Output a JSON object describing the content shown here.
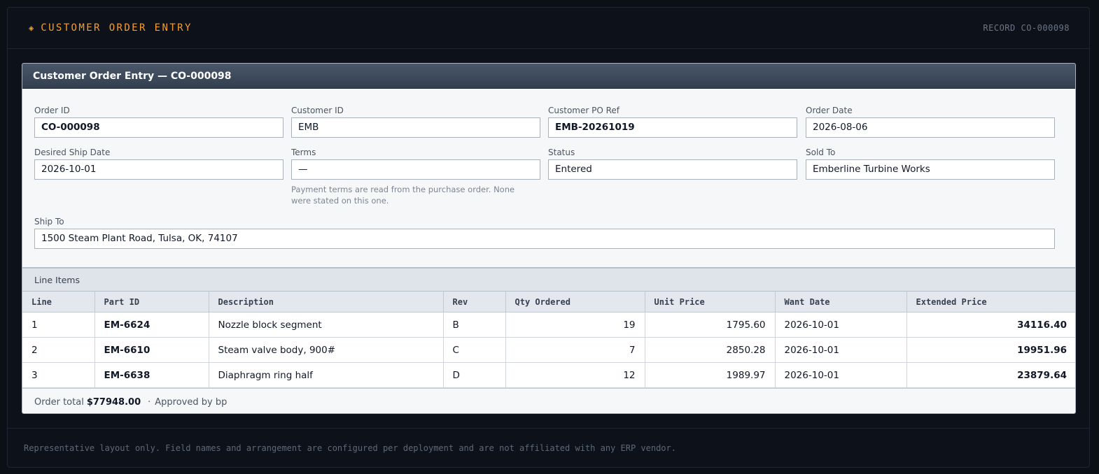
{
  "topbar": {
    "brand_icon": "◈",
    "brand_title": "CUSTOMER ORDER ENTRY",
    "record_label": "RECORD CO-000098"
  },
  "card": {
    "title": "Customer Order Entry — CO-000098"
  },
  "fields": {
    "order_id": {
      "label": "Order ID",
      "value": "CO-000098"
    },
    "customer_id": {
      "label": "Customer ID",
      "value": "EMB"
    },
    "customer_po_ref": {
      "label": "Customer PO Ref",
      "value": "EMB-20261019"
    },
    "order_date": {
      "label": "Order Date",
      "value": "2026-08-06"
    },
    "desired_ship_date": {
      "label": "Desired Ship Date",
      "value": "2026-10-01"
    },
    "terms": {
      "label": "Terms",
      "value": "—",
      "hint": "Payment terms are read from the purchase order. None were stated on this one."
    },
    "status": {
      "label": "Status",
      "value": "Entered"
    },
    "sold_to": {
      "label": "Sold To",
      "value": "Emberline Turbine Works"
    },
    "ship_to": {
      "label": "Ship To",
      "value": "1500 Steam Plant Road, Tulsa, OK, 74107"
    }
  },
  "line_items": {
    "section_title": "Line Items",
    "columns": [
      "Line",
      "Part ID",
      "Description",
      "Rev",
      "Qty Ordered",
      "Unit Price",
      "Want Date",
      "Extended Price"
    ],
    "rows": [
      {
        "line": "1",
        "part_id": "EM-6624",
        "description": "Nozzle block segment",
        "rev": "B",
        "qty": "19",
        "unit_price": "1795.60",
        "want_date": "2026-10-01",
        "extended": "34116.40"
      },
      {
        "line": "2",
        "part_id": "EM-6610",
        "description": "Steam valve body, 900#",
        "rev": "C",
        "qty": "7",
        "unit_price": "2850.28",
        "want_date": "2026-10-01",
        "extended": "19951.96"
      },
      {
        "line": "3",
        "part_id": "EM-6638",
        "description": "Diaphragm ring half",
        "rev": "D",
        "qty": "12",
        "unit_price": "1989.97",
        "want_date": "2026-10-01",
        "extended": "23879.64"
      }
    ]
  },
  "totals": {
    "order_total_label": "Order total",
    "order_total_value": "$77948.00",
    "separator": "·",
    "approved_label": "Approved by bp"
  },
  "footer": {
    "note": "Representative layout only. Field names and arrangement are configured per deployment and are not affiliated with any ERP vendor."
  },
  "colors": {
    "accent": "#f59e2c",
    "background": "#0b0f16",
    "header": "#3c4859"
  }
}
